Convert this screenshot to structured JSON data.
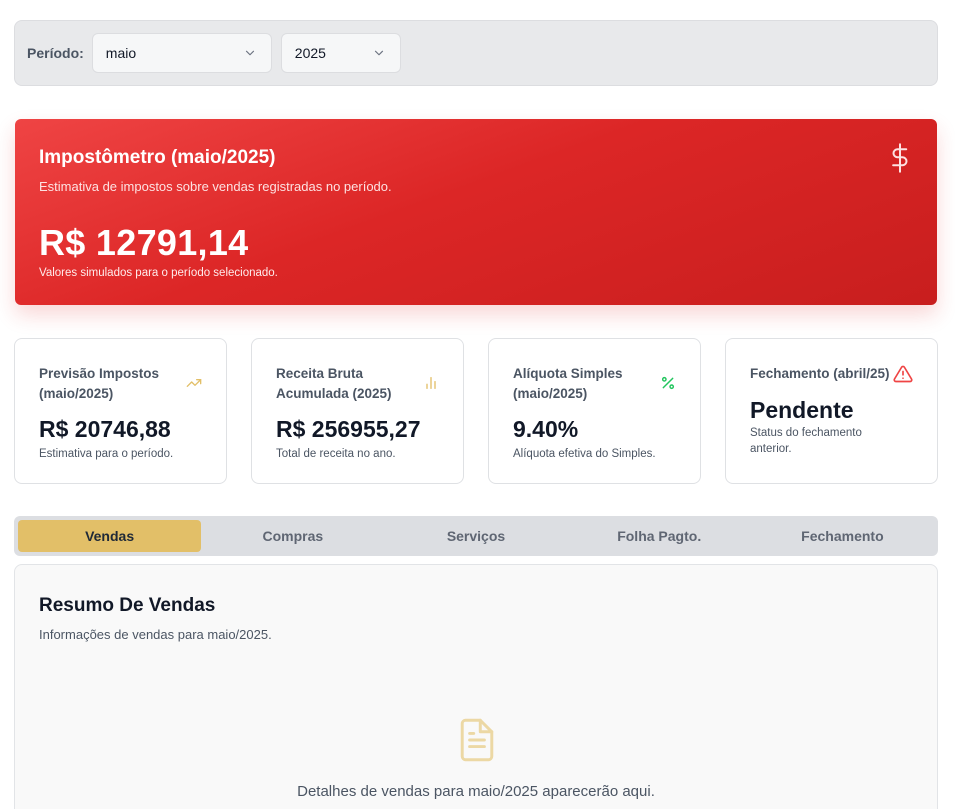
{
  "period": {
    "label": "Período:",
    "month_value": "maio",
    "year_value": "2025"
  },
  "hero": {
    "title": "Impostômetro (maio/2025)",
    "subtitle": "Estimativa de impostos sobre vendas registradas no período.",
    "value": "R$ 12791,14",
    "note": "Valores simulados para o período selecionado.",
    "icon": "dollar-icon",
    "color": "#dc2626"
  },
  "cards": [
    {
      "title": "Previsão Impostos (maio/2025)",
      "value": "R$ 20746,88",
      "note": "Estimativa para o período.",
      "icon": "trending-up-icon",
      "icon_color": "#e2bf68"
    },
    {
      "title": "Receita Bruta Acumulada (2025)",
      "value": "R$ 256955,27",
      "note": "Total de receita no ano.",
      "icon": "bar-chart-icon",
      "icon_color": "#e2bf68"
    },
    {
      "title": "Alíquota Simples (maio/2025)",
      "value": "9.40%",
      "note": "Alíquota efetiva do Simples.",
      "icon": "percent-icon",
      "icon_color": "#22c55e"
    },
    {
      "title": "Fechamento (abril/25)",
      "value": "Pendente",
      "note": "Status do fechamento anterior.",
      "icon": "alert-triangle-icon",
      "icon_color": "#ef4444"
    }
  ],
  "tabs": [
    {
      "label": "Vendas",
      "active": true
    },
    {
      "label": "Compras",
      "active": false
    },
    {
      "label": "Serviços",
      "active": false
    },
    {
      "label": "Folha Pagto.",
      "active": false
    },
    {
      "label": "Fechamento",
      "active": false
    }
  ],
  "panel": {
    "title": "Resumo De Vendas",
    "subtitle": "Informações de vendas para maio/2025.",
    "empty_text": "Detalhes de vendas para maio/2025 aparecerão aqui.",
    "icon": "document-icon"
  },
  "colors": {
    "accent": "#e2bf68",
    "hero": "#dc2626"
  }
}
